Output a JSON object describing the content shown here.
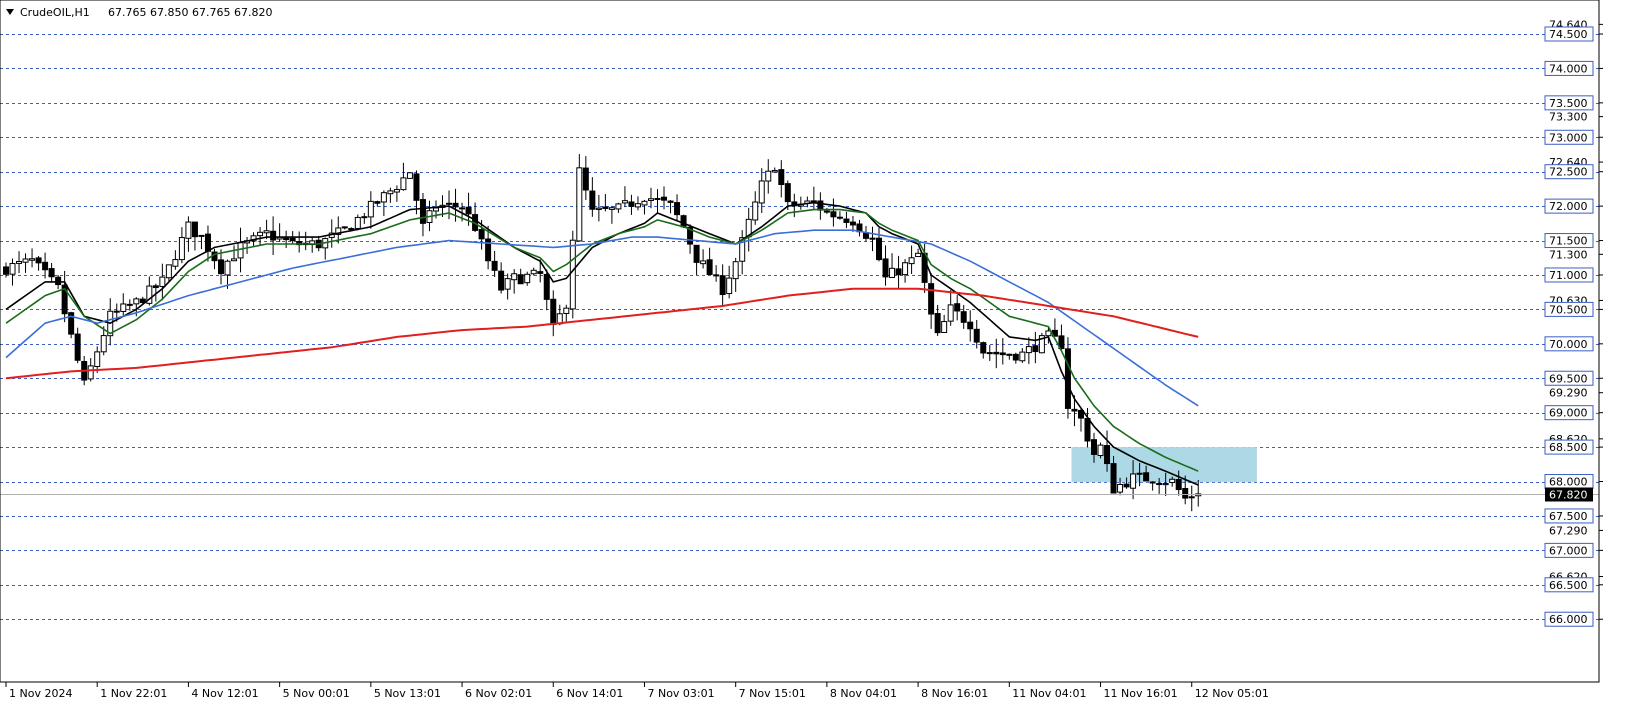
{
  "header": {
    "symbol_label": "CrudeOIL,H1",
    "ohlc_label": "67.765 67.850 67.765 67.820",
    "menu_icon": "triangle-down-icon"
  },
  "chart_data": {
    "type": "candlestick",
    "symbol": "CrudeOIL",
    "timeframe": "H1",
    "last_price": 67.82,
    "last_price_label": "67.820",
    "ylim": [
      65.8,
      74.8
    ],
    "grid": true,
    "dashed_levels": [
      74.5,
      74.0,
      73.5,
      73.0,
      72.5,
      72.0,
      71.5,
      71.0,
      70.5,
      70.0,
      69.5,
      69.0,
      68.5,
      68.0,
      67.5,
      67.0,
      66.5,
      66.0
    ],
    "y_tick_labels": [
      {
        "v": 74.64,
        "label": "74.640",
        "box": false
      },
      {
        "v": 74.5,
        "label": "74.500",
        "box": true
      },
      {
        "v": 74.0,
        "label": "74.000",
        "box": true
      },
      {
        "v": 73.5,
        "label": "73.500",
        "box": true
      },
      {
        "v": 73.3,
        "label": "73.300",
        "box": false
      },
      {
        "v": 73.0,
        "label": "73.000",
        "box": true
      },
      {
        "v": 72.64,
        "label": "72.640",
        "box": false
      },
      {
        "v": 72.5,
        "label": "72.500",
        "box": true
      },
      {
        "v": 72.0,
        "label": "72.000",
        "box": true
      },
      {
        "v": 71.5,
        "label": "71.500",
        "box": true
      },
      {
        "v": 71.3,
        "label": "71.300",
        "box": false
      },
      {
        "v": 71.0,
        "label": "71.000",
        "box": true
      },
      {
        "v": 70.63,
        "label": "70.630",
        "box": false
      },
      {
        "v": 70.5,
        "label": "70.500",
        "box": true
      },
      {
        "v": 70.0,
        "label": "70.000",
        "box": true
      },
      {
        "v": 69.5,
        "label": "69.500",
        "box": true
      },
      {
        "v": 69.29,
        "label": "69.290",
        "box": false
      },
      {
        "v": 69.0,
        "label": "69.000",
        "box": true
      },
      {
        "v": 68.62,
        "label": "68.620",
        "box": false
      },
      {
        "v": 68.5,
        "label": "68.500",
        "box": true
      },
      {
        "v": 68.0,
        "label": "68.000",
        "box": true
      },
      {
        "v": 67.5,
        "label": "67.500",
        "box": true
      },
      {
        "v": 67.29,
        "label": "67.290",
        "box": false
      },
      {
        "v": 67.0,
        "label": "67.000",
        "box": true
      },
      {
        "v": 66.62,
        "label": "66.620",
        "box": false
      },
      {
        "v": 66.5,
        "label": "66.500",
        "box": true
      },
      {
        "v": 66.0,
        "label": "66.000",
        "box": true
      }
    ],
    "x_tick_labels": [
      {
        "i": 0,
        "label": "1 Nov 2024"
      },
      {
        "i": 14,
        "label": "1 Nov 22:01"
      },
      {
        "i": 28,
        "label": "4 Nov 12:01"
      },
      {
        "i": 42,
        "label": "5 Nov 00:01"
      },
      {
        "i": 56,
        "label": "5 Nov 13:01"
      },
      {
        "i": 70,
        "label": "6 Nov 02:01"
      },
      {
        "i": 84,
        "label": "6 Nov 14:01"
      },
      {
        "i": 98,
        "label": "7 Nov 03:01"
      },
      {
        "i": 112,
        "label": "7 Nov 15:01"
      },
      {
        "i": 126,
        "label": "8 Nov 04:01"
      },
      {
        "i": 140,
        "label": "8 Nov 16:01"
      },
      {
        "i": 154,
        "label": "11 Nov 04:01"
      },
      {
        "i": 168,
        "label": "11 Nov 16:01"
      },
      {
        "i": 182,
        "label": "12 Nov 05:01"
      }
    ],
    "candle_count": 184,
    "price_path_anchors": [
      [
        0,
        71.1
      ],
      [
        4,
        71.2
      ],
      [
        8,
        70.8
      ],
      [
        10,
        70.1
      ],
      [
        12,
        69.4
      ],
      [
        16,
        70.4
      ],
      [
        20,
        70.6
      ],
      [
        24,
        70.9
      ],
      [
        28,
        71.7
      ],
      [
        30,
        71.55
      ],
      [
        33,
        71.1
      ],
      [
        36,
        71.4
      ],
      [
        40,
        71.6
      ],
      [
        44,
        71.45
      ],
      [
        48,
        71.45
      ],
      [
        52,
        71.65
      ],
      [
        55,
        71.9
      ],
      [
        60,
        72.3
      ],
      [
        62,
        72.5
      ],
      [
        64,
        71.7
      ],
      [
        66,
        72.0
      ],
      [
        70,
        72.0
      ],
      [
        72,
        71.7
      ],
      [
        74,
        71.2
      ],
      [
        76,
        70.8
      ],
      [
        78,
        70.95
      ],
      [
        82,
        71.0
      ],
      [
        84,
        70.2
      ],
      [
        86,
        70.6
      ],
      [
        88,
        72.5
      ],
      [
        90,
        71.9
      ],
      [
        94,
        71.95
      ],
      [
        98,
        72.15
      ],
      [
        102,
        72.0
      ],
      [
        104,
        71.7
      ],
      [
        106,
        71.25
      ],
      [
        110,
        70.8
      ],
      [
        112,
        71.2
      ],
      [
        116,
        72.3
      ],
      [
        118,
        72.6
      ],
      [
        120,
        72.0
      ],
      [
        124,
        72.05
      ],
      [
        126,
        71.9
      ],
      [
        130,
        71.8
      ],
      [
        133,
        71.5
      ],
      [
        135,
        70.95
      ],
      [
        139,
        71.2
      ],
      [
        140,
        71.3
      ],
      [
        142,
        70.4
      ],
      [
        143,
        70.1
      ],
      [
        145,
        70.5
      ],
      [
        148,
        70.3
      ],
      [
        150,
        69.9
      ],
      [
        153,
        69.85
      ],
      [
        156,
        69.85
      ],
      [
        160,
        70.1
      ],
      [
        162,
        70.0
      ],
      [
        163,
        69.1
      ],
      [
        165,
        68.9
      ],
      [
        167,
        68.4
      ],
      [
        168,
        68.5
      ],
      [
        170,
        67.9
      ],
      [
        173,
        68.05
      ],
      [
        176,
        68.05
      ],
      [
        179,
        68.0
      ],
      [
        181,
        67.75
      ],
      [
        182,
        67.8
      ],
      [
        183,
        67.82
      ]
    ],
    "series": [
      {
        "key": "ma_black",
        "color": "#000000",
        "width": 1.6,
        "anchors": [
          [
            0,
            70.5
          ],
          [
            6,
            70.9
          ],
          [
            9,
            70.9
          ],
          [
            12,
            70.4
          ],
          [
            16,
            70.3
          ],
          [
            20,
            70.5
          ],
          [
            24,
            70.8
          ],
          [
            28,
            71.2
          ],
          [
            32,
            71.4
          ],
          [
            40,
            71.55
          ],
          [
            48,
            71.55
          ],
          [
            56,
            71.7
          ],
          [
            62,
            71.95
          ],
          [
            68,
            72.0
          ],
          [
            72,
            71.8
          ],
          [
            78,
            71.4
          ],
          [
            82,
            71.2
          ],
          [
            84,
            70.9
          ],
          [
            86,
            70.95
          ],
          [
            90,
            71.4
          ],
          [
            94,
            71.6
          ],
          [
            98,
            71.75
          ],
          [
            100,
            71.9
          ],
          [
            104,
            71.75
          ],
          [
            108,
            71.6
          ],
          [
            112,
            71.45
          ],
          [
            116,
            71.7
          ],
          [
            120,
            72.0
          ],
          [
            124,
            72.05
          ],
          [
            128,
            72.0
          ],
          [
            132,
            71.9
          ],
          [
            134,
            71.7
          ],
          [
            136,
            71.6
          ],
          [
            140,
            71.45
          ],
          [
            142,
            71.0
          ],
          [
            145,
            70.8
          ],
          [
            148,
            70.6
          ],
          [
            151,
            70.35
          ],
          [
            154,
            70.1
          ],
          [
            158,
            70.05
          ],
          [
            160,
            70.1
          ],
          [
            162,
            69.6
          ],
          [
            164,
            69.2
          ],
          [
            167,
            68.8
          ],
          [
            170,
            68.5
          ],
          [
            174,
            68.3
          ],
          [
            178,
            68.15
          ],
          [
            183,
            67.95
          ]
        ]
      },
      {
        "key": "ma_green",
        "color": "#1a6b1a",
        "width": 1.6,
        "anchors": [
          [
            0,
            70.3
          ],
          [
            6,
            70.7
          ],
          [
            9,
            70.8
          ],
          [
            12,
            70.4
          ],
          [
            16,
            70.15
          ],
          [
            20,
            70.35
          ],
          [
            24,
            70.65
          ],
          [
            28,
            71.05
          ],
          [
            32,
            71.3
          ],
          [
            40,
            71.45
          ],
          [
            48,
            71.45
          ],
          [
            56,
            71.6
          ],
          [
            62,
            71.8
          ],
          [
            68,
            71.9
          ],
          [
            72,
            71.75
          ],
          [
            78,
            71.4
          ],
          [
            82,
            71.25
          ],
          [
            84,
            71.05
          ],
          [
            86,
            71.15
          ],
          [
            90,
            71.45
          ],
          [
            94,
            71.6
          ],
          [
            98,
            71.7
          ],
          [
            100,
            71.8
          ],
          [
            104,
            71.7
          ],
          [
            108,
            71.55
          ],
          [
            112,
            71.45
          ],
          [
            116,
            71.65
          ],
          [
            120,
            71.9
          ],
          [
            124,
            71.95
          ],
          [
            128,
            71.95
          ],
          [
            132,
            71.9
          ],
          [
            134,
            71.75
          ],
          [
            136,
            71.65
          ],
          [
            140,
            71.5
          ],
          [
            142,
            71.15
          ],
          [
            145,
            70.95
          ],
          [
            148,
            70.8
          ],
          [
            151,
            70.6
          ],
          [
            154,
            70.4
          ],
          [
            158,
            70.3
          ],
          [
            160,
            70.25
          ],
          [
            162,
            69.9
          ],
          [
            164,
            69.5
          ],
          [
            167,
            69.1
          ],
          [
            170,
            68.8
          ],
          [
            174,
            68.55
          ],
          [
            178,
            68.35
          ],
          [
            183,
            68.15
          ]
        ]
      },
      {
        "key": "ma_blue",
        "color": "#3a6fd8",
        "width": 1.6,
        "anchors": [
          [
            0,
            69.8
          ],
          [
            6,
            70.3
          ],
          [
            10,
            70.4
          ],
          [
            14,
            70.3
          ],
          [
            20,
            70.45
          ],
          [
            28,
            70.7
          ],
          [
            36,
            70.9
          ],
          [
            44,
            71.1
          ],
          [
            52,
            71.25
          ],
          [
            60,
            71.4
          ],
          [
            68,
            71.5
          ],
          [
            76,
            71.45
          ],
          [
            84,
            71.4
          ],
          [
            90,
            71.45
          ],
          [
            96,
            71.55
          ],
          [
            100,
            71.55
          ],
          [
            106,
            71.5
          ],
          [
            112,
            71.45
          ],
          [
            118,
            71.6
          ],
          [
            124,
            71.65
          ],
          [
            130,
            71.65
          ],
          [
            136,
            71.55
          ],
          [
            142,
            71.45
          ],
          [
            148,
            71.2
          ],
          [
            154,
            70.9
          ],
          [
            160,
            70.6
          ],
          [
            166,
            70.2
          ],
          [
            172,
            69.8
          ],
          [
            178,
            69.4
          ],
          [
            183,
            69.1
          ]
        ]
      },
      {
        "key": "ma_red",
        "color": "#e02020",
        "width": 2,
        "anchors": [
          [
            0,
            69.5
          ],
          [
            10,
            69.6
          ],
          [
            20,
            69.65
          ],
          [
            30,
            69.75
          ],
          [
            40,
            69.85
          ],
          [
            50,
            69.95
          ],
          [
            60,
            70.1
          ],
          [
            70,
            70.2
          ],
          [
            80,
            70.25
          ],
          [
            90,
            70.35
          ],
          [
            100,
            70.45
          ],
          [
            110,
            70.55
          ],
          [
            120,
            70.7
          ],
          [
            130,
            70.8
          ],
          [
            140,
            70.8
          ],
          [
            150,
            70.7
          ],
          [
            160,
            70.55
          ],
          [
            170,
            70.4
          ],
          [
            183,
            70.1
          ]
        ]
      }
    ],
    "zone": {
      "from_index": 164,
      "to_index": 192,
      "top": 68.5,
      "bottom": 67.99,
      "color": "#add8e6"
    }
  }
}
